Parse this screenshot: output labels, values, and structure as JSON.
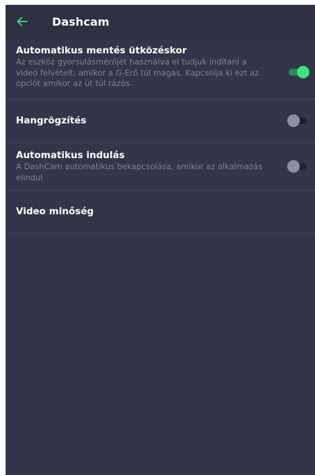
{
  "header": {
    "title": "Dashcam",
    "back_icon": "arrow-left-icon",
    "accent_color": "#3ee17f"
  },
  "settings": [
    {
      "title": "Automatikus mentés ütközéskor",
      "description": "Az eszköz gyorsulásmérőjét használva el tudjuk indítani a videó felvételt, amikor a G-Erő túl magas. Kapcsolja ki ezt az opciót amikor az út túl rázós.",
      "enabled": true
    },
    {
      "title": "Hangrögzítés",
      "enabled": false
    },
    {
      "title": "Automatikus indulás",
      "description": "A DashCam automatikus bekapcsolása, amikor az alkalmazás elindul",
      "enabled": false
    },
    {
      "title": "Video minőség"
    }
  ]
}
